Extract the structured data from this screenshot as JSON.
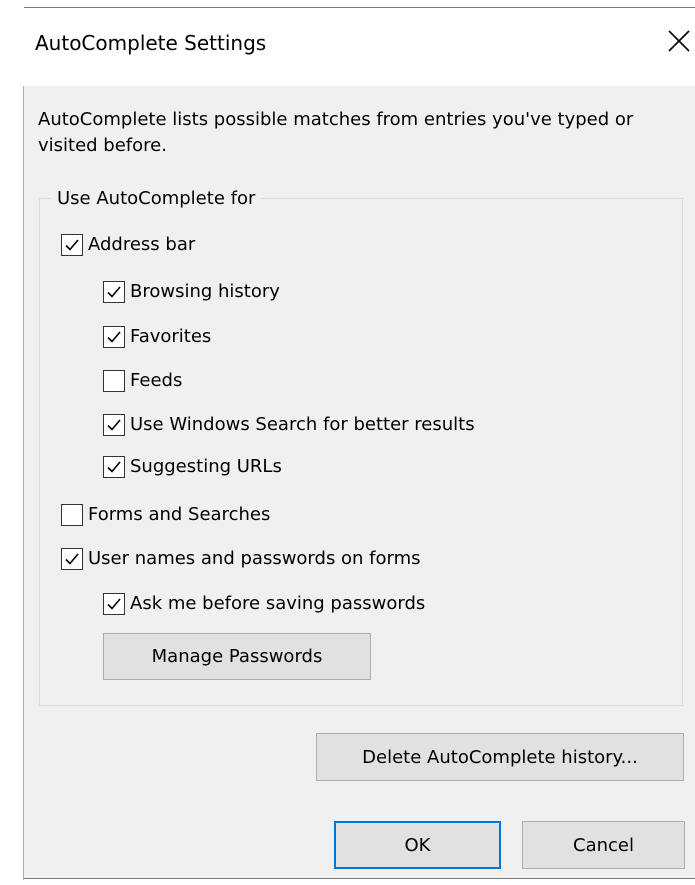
{
  "title": "AutoComplete Settings",
  "description": "AutoComplete lists possible matches from entries you've typed or visited before.",
  "group": {
    "label": "Use AutoComplete for",
    "items": [
      {
        "label": "Address bar",
        "checked": true
      },
      {
        "label": "Browsing history",
        "checked": true
      },
      {
        "label": "Favorites",
        "checked": true
      },
      {
        "label": "Feeds",
        "checked": false
      },
      {
        "label": "Use Windows Search for better results",
        "checked": true
      },
      {
        "label": "Suggesting URLs",
        "checked": true
      },
      {
        "label": "Forms and Searches",
        "checked": false
      },
      {
        "label": "User names and passwords on forms",
        "checked": true
      },
      {
        "label": "Ask me before saving passwords",
        "checked": true
      }
    ],
    "manage_passwords_label": "Manage Passwords"
  },
  "delete_history_label": "Delete AutoComplete history...",
  "ok_label": "OK",
  "cancel_label": "Cancel",
  "colors": {
    "accent": "#0078d7",
    "dialog_bg": "#f0f0f0",
    "button_bg": "#e1e1e1"
  }
}
